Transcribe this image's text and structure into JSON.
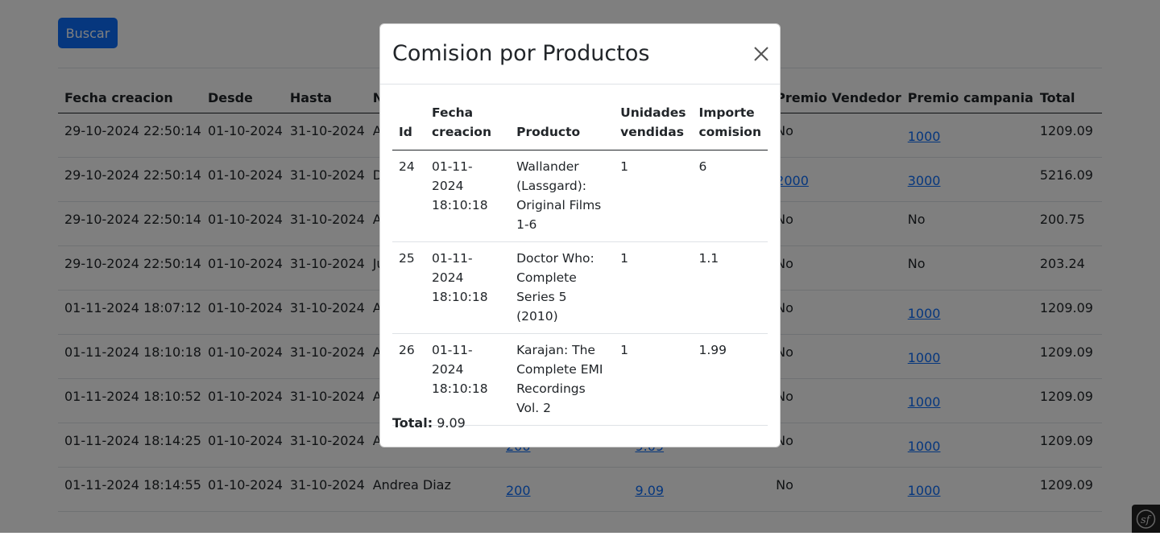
{
  "search": {
    "button_label": "Buscar"
  },
  "table": {
    "headers": [
      "Fecha creacion",
      "Desde",
      "Hasta",
      "No",
      "",
      "",
      "Premio Vendedor",
      "Premio campania",
      "Total"
    ],
    "rows": [
      {
        "fecha": "29-10-2024 22:50:14",
        "desde": "01-10-2024",
        "hasta": "31-10-2024",
        "nombre": "Ar",
        "c5": "",
        "c6": "",
        "premio_vendedor": "No",
        "premio_vendedor_link": false,
        "premio_campania": "1000",
        "premio_campania_link": true,
        "total": "1209.09"
      },
      {
        "fecha": "29-10-2024 22:50:14",
        "desde": "01-10-2024",
        "hasta": "31-10-2024",
        "nombre": "De",
        "c5": "",
        "c6": "",
        "premio_vendedor": "2000",
        "premio_vendedor_link": true,
        "premio_campania": "3000",
        "premio_campania_link": true,
        "total": "5216.09"
      },
      {
        "fecha": "29-10-2024 22:50:14",
        "desde": "01-10-2024",
        "hasta": "31-10-2024",
        "nombre": "Ar",
        "c5": "",
        "c6": "",
        "premio_vendedor": "No",
        "premio_vendedor_link": false,
        "premio_campania": "No",
        "premio_campania_link": false,
        "total": "200.75"
      },
      {
        "fecha": "29-10-2024 22:50:14",
        "desde": "01-10-2024",
        "hasta": "31-10-2024",
        "nombre": "Ju",
        "c5": "",
        "c6": "",
        "premio_vendedor": "No",
        "premio_vendedor_link": false,
        "premio_campania": "No",
        "premio_campania_link": false,
        "total": "203.24"
      },
      {
        "fecha": "01-11-2024 18:07:12",
        "desde": "01-10-2024",
        "hasta": "31-10-2024",
        "nombre": "Ar",
        "c5": "",
        "c6": "",
        "premio_vendedor": "No",
        "premio_vendedor_link": false,
        "premio_campania": "1000",
        "premio_campania_link": true,
        "total": "1209.09"
      },
      {
        "fecha": "01-11-2024 18:10:18",
        "desde": "01-10-2024",
        "hasta": "31-10-2024",
        "nombre": "Ar",
        "c5": "",
        "c6": "",
        "premio_vendedor": "No",
        "premio_vendedor_link": false,
        "premio_campania": "1000",
        "premio_campania_link": true,
        "total": "1209.09"
      },
      {
        "fecha": "01-11-2024 18:10:52",
        "desde": "01-10-2024",
        "hasta": "31-10-2024",
        "nombre": "Ar",
        "c5": "",
        "c6": "",
        "premio_vendedor": "No",
        "premio_vendedor_link": false,
        "premio_campania": "1000",
        "premio_campania_link": true,
        "total": "1209.09"
      },
      {
        "fecha": "01-11-2024 18:14:25",
        "desde": "01-10-2024",
        "hasta": "31-10-2024",
        "nombre": "Ar",
        "c5": "200",
        "c6": "9.09",
        "premio_vendedor": "No",
        "premio_vendedor_link": false,
        "premio_campania": "1000",
        "premio_campania_link": true,
        "total": "1209.09"
      },
      {
        "fecha": "01-11-2024 18:14:55",
        "desde": "01-10-2024",
        "hasta": "31-10-2024",
        "nombre": "Andrea Diaz",
        "c5": "200",
        "c6": "9.09",
        "premio_vendedor": "No",
        "premio_vendedor_link": false,
        "premio_campania": "1000",
        "premio_campania_link": true,
        "total": "1209.09"
      }
    ]
  },
  "modal": {
    "title": "Comision por Productos",
    "close_icon": "close-icon",
    "headers": [
      "Id",
      "Fecha creacion",
      "Producto",
      "Unidades vendidas",
      "Importe comision"
    ],
    "rows": [
      {
        "id": "24",
        "fecha": "01-11-2024 18:10:18",
        "producto": "Wallander (Lassgard): Original Films 1-6",
        "unidades": "1",
        "importe": "6"
      },
      {
        "id": "25",
        "fecha": "01-11-2024 18:10:18",
        "producto": "Doctor Who: Complete Series 5 (2010)",
        "unidades": "1",
        "importe": "1.1"
      },
      {
        "id": "26",
        "fecha": "01-11-2024 18:10:18",
        "producto": "Karajan: The Complete EMI Recordings Vol. 2",
        "unidades": "1",
        "importe": "1.99"
      }
    ],
    "total_label": "Total:",
    "total_value": "9.09"
  },
  "badge": {
    "label": "sf",
    "icon": "symfony-icon"
  },
  "colors": {
    "primary": "#0d6efd",
    "overlay": "rgba(0,0,0,0.5)"
  }
}
